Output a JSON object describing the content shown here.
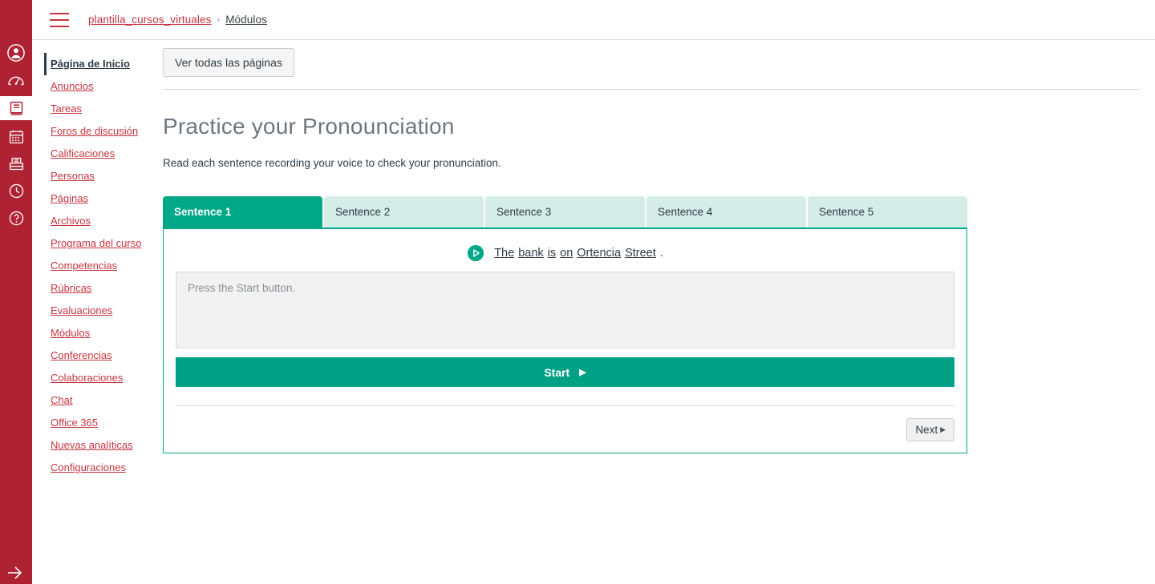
{
  "global_nav": {
    "items": [
      {
        "name": "account-icon",
        "label": "Cuenta",
        "active": false
      },
      {
        "name": "dashboard-icon",
        "label": "Tablero",
        "active": false
      },
      {
        "name": "courses-icon",
        "label": "Cursos",
        "active": true
      },
      {
        "name": "calendar-icon",
        "label": "Calendario",
        "active": false
      },
      {
        "name": "inbox-icon",
        "label": "Bandeja de entrada",
        "active": false
      },
      {
        "name": "history-icon",
        "label": "Historial",
        "active": false
      },
      {
        "name": "help-icon",
        "label": "Ayuda",
        "active": false
      }
    ],
    "collapse_label": "Minimizar"
  },
  "topbar": {
    "menu_icon": "hamburger-icon",
    "breadcrumb": {
      "course": "plantilla_cursos_virtuales",
      "separator": "›",
      "current": "Módulos"
    }
  },
  "course_nav": {
    "items": [
      {
        "label": "Página de Inicio",
        "active": true
      },
      {
        "label": "Anuncios",
        "active": false
      },
      {
        "label": "Tareas",
        "active": false
      },
      {
        "label": "Foros de discusión",
        "active": false
      },
      {
        "label": "Calificaciones",
        "active": false
      },
      {
        "label": "Personas",
        "active": false
      },
      {
        "label": "Páginas",
        "active": false
      },
      {
        "label": "Archivos",
        "active": false
      },
      {
        "label": "Programa del curso",
        "active": false
      },
      {
        "label": "Competencias",
        "active": false
      },
      {
        "label": "Rúbricas",
        "active": false
      },
      {
        "label": "Evaluaciones",
        "active": false
      },
      {
        "label": "Módulos",
        "active": false
      },
      {
        "label": "Conferencias",
        "active": false
      },
      {
        "label": "Colaboraciones",
        "active": false
      },
      {
        "label": "Chat",
        "active": false
      },
      {
        "label": "Office 365",
        "active": false
      },
      {
        "label": "Nuevas analíticas",
        "active": false
      },
      {
        "label": "Configuraciones",
        "active": false
      }
    ]
  },
  "main": {
    "view_all_pages_label": "Ver todas las páginas",
    "title": "Practice your Pronounciation",
    "description": "Read each sentence recording your voice to check your pronunciation.",
    "tabs": [
      {
        "label": "Sentence 1",
        "active": true
      },
      {
        "label": "Sentence 2",
        "active": false
      },
      {
        "label": "Sentence 3",
        "active": false
      },
      {
        "label": "Sentence 4",
        "active": false
      },
      {
        "label": "Sentence 5",
        "active": false
      }
    ],
    "exercise": {
      "play_icon": "play-circle-icon",
      "words": [
        "The",
        "bank",
        "is",
        "on",
        "Ortencia",
        "Street"
      ],
      "punctuation": ".",
      "transcript_placeholder": "Press the Start button.",
      "transcript_value": "",
      "start_label": "Start",
      "start_icon": "play-triangle-icon",
      "next_label": "Next",
      "next_icon": "triangle-right-icon"
    }
  },
  "colors": {
    "brand_red": "#AF2232",
    "link_red": "#C7343F",
    "accent_teal": "#00A887",
    "tab_inactive": "#D4EDE6",
    "text_dark": "#2D3B45"
  }
}
